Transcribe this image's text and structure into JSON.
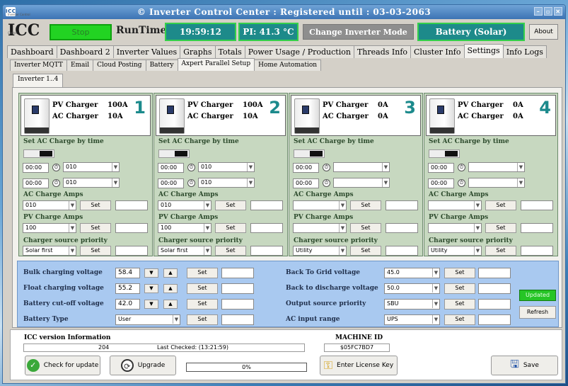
{
  "window": {
    "title": "© Inverter Control Center : Registered until : 03-03-2063",
    "icon": "icc-app-icon"
  },
  "header": {
    "logo": "ICC",
    "logo_sub": "Inverter Control Center",
    "stop": "Stop",
    "runtime_label": "RunTime",
    "time": "19:59:12",
    "pi_temp": "PI: 41.3 °C",
    "change_mode": "Change Inverter Mode",
    "mode": "Battery (Solar)",
    "about": "About"
  },
  "tabs": [
    "Dashboard",
    "Dashboard 2",
    "Inverter Values",
    "Graphs",
    "Totals",
    "Power Usage / Production",
    "Threads Info",
    "Cluster Info",
    "Settings",
    "Info Logs"
  ],
  "subtabs": [
    "Inverter MQTT",
    "Email",
    "Cloud Posting",
    "Battery",
    "Axpert Parallel Setup",
    "Home Automation"
  ],
  "inverter_tab": "Inverter 1..4",
  "labels": {
    "pv_charger": "PV Charger",
    "ac_charger": "AC Charger",
    "set_ac_by_time": "Set AC Charge by time",
    "ac_amps": "AC Charge Amps",
    "pv_amps": "PV Charge Amps",
    "priority": "Charger source priority",
    "set": "Set"
  },
  "inverters": [
    {
      "num": "1",
      "pv": "100A",
      "ac": "10A",
      "t1": "00:00",
      "s1": "010",
      "t2": "00:00",
      "s2": "010",
      "ac_amps": "010",
      "pv_amps": "100",
      "priority": "Solar first"
    },
    {
      "num": "2",
      "pv": "100A",
      "ac": "10A",
      "t1": "00:00",
      "s1": "010",
      "t2": "00:00",
      "s2": "010",
      "ac_amps": "010",
      "pv_amps": "100",
      "priority": "Solar first"
    },
    {
      "num": "3",
      "pv": "0A",
      "ac": "0A",
      "t1": "00:00",
      "s1": "",
      "t2": "00:00",
      "s2": "",
      "ac_amps": "",
      "pv_amps": "",
      "priority": "Utility"
    },
    {
      "num": "4",
      "pv": "0A",
      "ac": "0A",
      "t1": "00:00",
      "s1": "",
      "t2": "00:00",
      "s2": "",
      "ac_amps": "",
      "pv_amps": "",
      "priority": "Utility"
    }
  ],
  "battery": {
    "bulk_label": "Bulk charging voltage",
    "bulk": "58.4",
    "float_label": "Float charging voltage",
    "float": "55.2",
    "cutoff_label": "Battery cut-off voltage",
    "cutoff": "42.0",
    "type_label": "Battery Type",
    "type": "User",
    "grid_label": "Back To Grid voltage",
    "grid": "45.0",
    "discharge_label": "Back to discharge voltage",
    "discharge": "50.0",
    "out_label": "Output source priority",
    "out": "SBU",
    "acin_label": "AC input range",
    "acin": "UPS",
    "updated": "Updated",
    "refresh": "Refresh"
  },
  "footer": {
    "version_title": "ICC version Information",
    "version": "204",
    "last_checked": "Last Checked: (13:21:59)",
    "machine_title": "MACHINE ID",
    "machine_id": "$05FC7BD7",
    "check": "Check for update",
    "upgrade": "Upgrade",
    "progress": "0%",
    "license": "Enter License Key",
    "save": "Save"
  }
}
